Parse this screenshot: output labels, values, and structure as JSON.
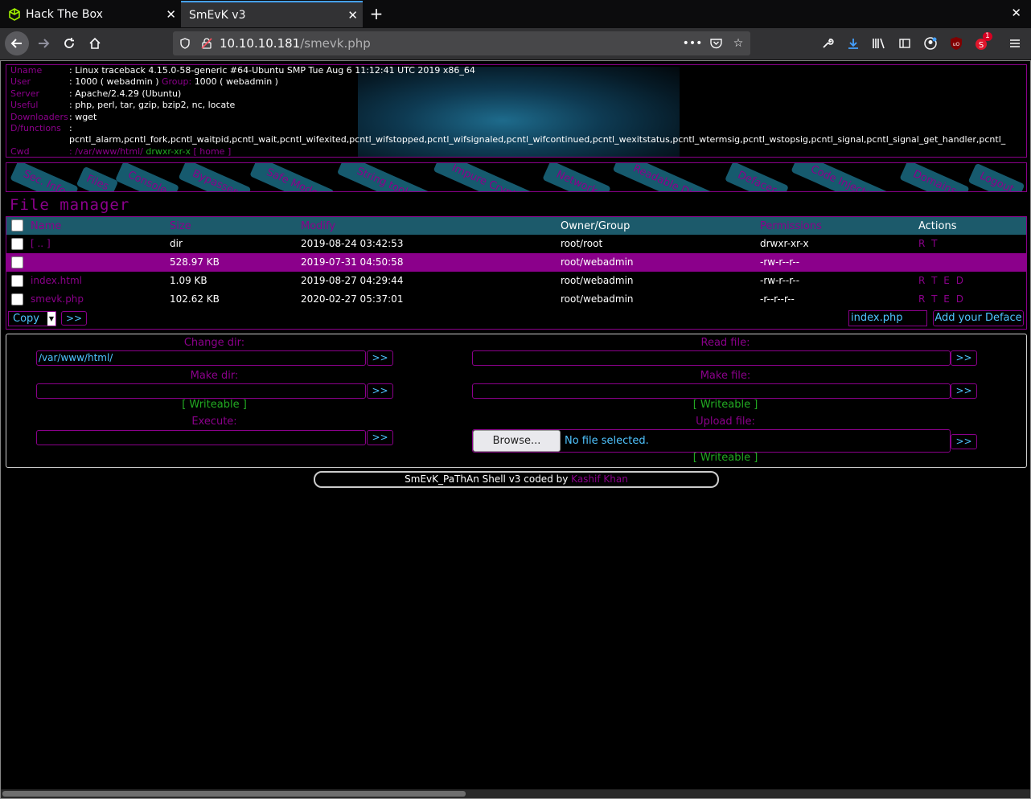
{
  "browser": {
    "tabs": [
      {
        "title": "Hack The Box",
        "active": false
      },
      {
        "title": "SmEvK v3",
        "active": true
      }
    ],
    "new_tab": "+",
    "window_close": "✕",
    "url_host": "10.10.10.181",
    "url_path": "/smevk.php",
    "accent": "#45a1ff",
    "badge_count": "1"
  },
  "info": {
    "rows": [
      {
        "key": "Uname",
        "value": ": Linux traceback 4.15.0-58-generic #64-Ubuntu SMP Tue Aug 6 11:12:41 UTC 2019 x86_64"
      },
      {
        "key": "User",
        "value": ": 1000 ( webadmin )",
        "group_label": "Group:",
        "group_value": "1000 ( webadmin )"
      },
      {
        "key": "Server",
        "value": ": Apache/2.4.29 (Ubuntu)"
      },
      {
        "key": "Useful",
        "value": ": php, perl, tar, gzip, bzip2, nc, locate"
      },
      {
        "key": "Downloaders",
        "value": ": wget"
      },
      {
        "key": "D/functions",
        "value": ":"
      },
      {
        "key": "",
        "value": "pcntl_alarm,pcntl_fork,pcntl_waitpid,pcntl_wait,pcntl_wifexited,pcntl_wifstopped,pcntl_wifsignaled,pcntl_wifcontinued,pcntl_wexitstatus,pcntl_wtermsig,pcntl_wstopsig,pcntl_signal,pcntl_signal_get_handler,pcntl_"
      },
      {
        "key": "Cwd",
        "value": ": /var/www/html/",
        "perm": "drwxr-xr-x",
        "home": "[ home ]"
      }
    ]
  },
  "menu": [
    "Sec. Info",
    "Files",
    "Console",
    "Bypasser",
    "Safe Mode",
    "String tools",
    "Impure Crypto",
    "Network",
    "Readable Dirs",
    "Defacer",
    "Code Injector",
    "Domains",
    "Logout"
  ],
  "file_manager": {
    "title": "File manager",
    "columns": [
      "Name",
      "Size",
      "Modify",
      "Owner/Group",
      "Permissions",
      "Actions"
    ],
    "rows": [
      {
        "name": "[ .. ]",
        "size": "dir",
        "modify": "2019-08-24 03:42:53",
        "owner": "root/root",
        "perms": "drwxr-xr-x",
        "actions": "R T"
      },
      {
        "name": "",
        "size": "528.97 KB",
        "modify": "2019-07-31 04:50:58",
        "owner": "root/webadmin",
        "perms": "-rw-r--r--",
        "actions": ""
      },
      {
        "name": "index.html",
        "size": "1.09 KB",
        "modify": "2019-08-27 04:29:44",
        "owner": "root/webadmin",
        "perms": "-rw-r--r--",
        "actions": "R T E D"
      },
      {
        "name": "smevk.php",
        "size": "102.62 KB",
        "modify": "2020-02-27 05:37:01",
        "owner": "root/webadmin",
        "perms": "-r--r--r--",
        "actions": "R T E D"
      }
    ],
    "copy_select": "Copy",
    "go": ">>",
    "deface_input": "index.php",
    "deface_button": "Add your Deface"
  },
  "forms": {
    "change_dir_label": "Change dir:",
    "change_dir_value": "/var/www/html/",
    "read_file_label": "Read file:",
    "make_dir_label": "Make dir:",
    "make_file_label": "Make file:",
    "writeable": "[ Writeable ]",
    "execute_label": "Execute:",
    "upload_label": "Upload file:",
    "browse": "Browse...",
    "no_file": "No file selected.",
    "go": ">>"
  },
  "footer": {
    "text": "SmEvK_PaThAn Shell v3 coded by ",
    "author": "Kashif Khan"
  },
  "colors": {
    "magenta": "#8b008b",
    "teal": "#1c5a6b",
    "green": "#22aa22",
    "cyan": "#4fc4ff"
  }
}
